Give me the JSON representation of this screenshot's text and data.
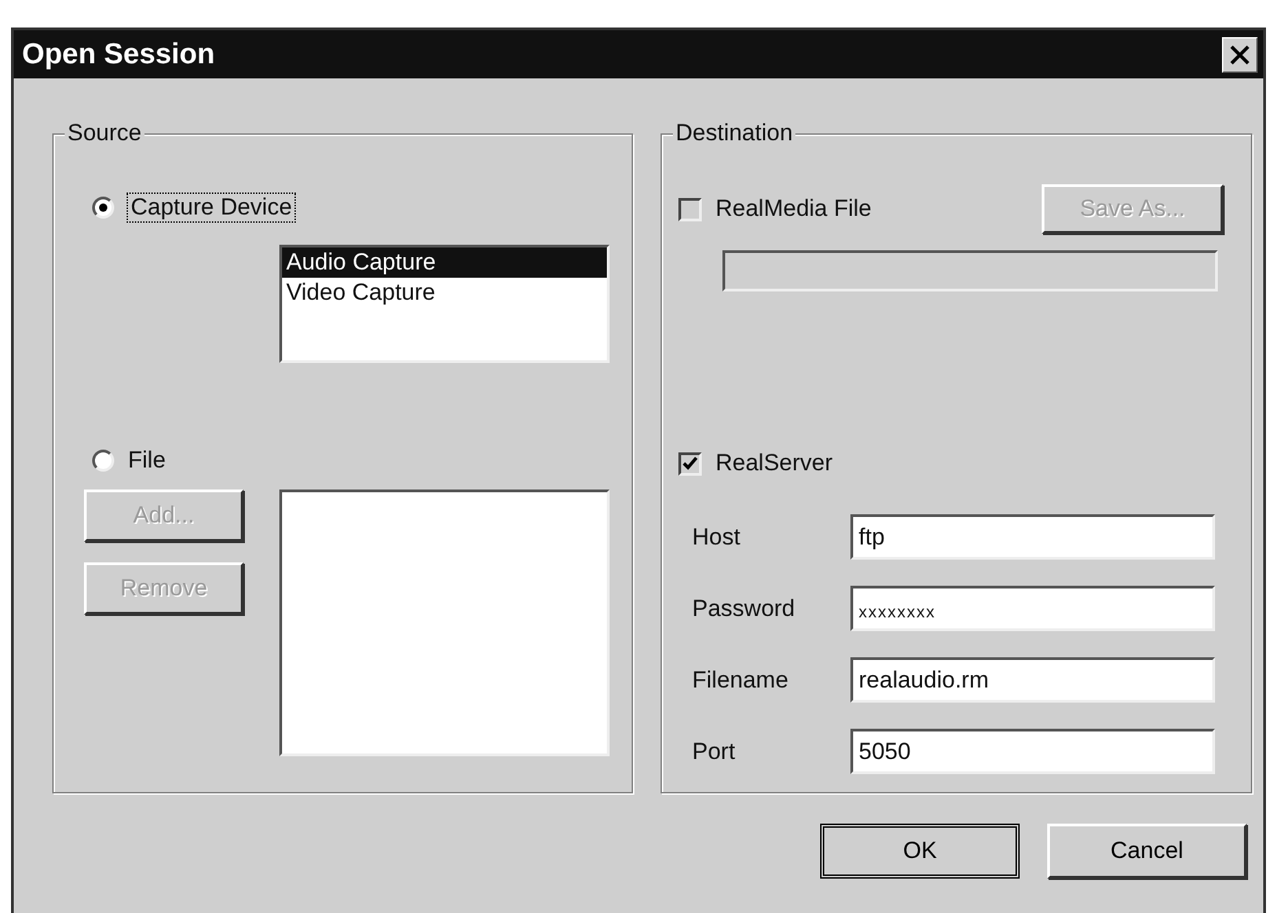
{
  "window": {
    "title": "Open Session"
  },
  "source": {
    "label": "Source",
    "options": [
      {
        "kind": "device",
        "label": "Capture Device",
        "selected": true
      },
      {
        "kind": "file",
        "label": "File",
        "selected": false
      }
    ],
    "devices": [
      {
        "label": "Audio Capture",
        "selected": true
      },
      {
        "label": "Video Capture",
        "selected": false
      }
    ],
    "file_buttons": [
      {
        "label": "Add...",
        "disabled": true
      },
      {
        "label": "Remove",
        "disabled": true
      }
    ]
  },
  "destination": {
    "label": "Destination",
    "realmedia": {
      "label": "RealMedia File",
      "checked": false
    },
    "save_as": {
      "label": "Save As...",
      "disabled": true
    },
    "file_path": {
      "disabled": true
    },
    "realserver": {
      "label": "RealServer",
      "checked": true
    },
    "fields": [
      {
        "label": "Host",
        "value": "ftp"
      },
      {
        "label": "Password",
        "value": "xxxxxxxx"
      },
      {
        "label": "Filename",
        "value": "realaudio.rm"
      },
      {
        "label": "Port",
        "value": "5050"
      }
    ]
  },
  "buttons": [
    {
      "label": "OK",
      "default": true
    },
    {
      "label": "Cancel",
      "default": false
    }
  ]
}
